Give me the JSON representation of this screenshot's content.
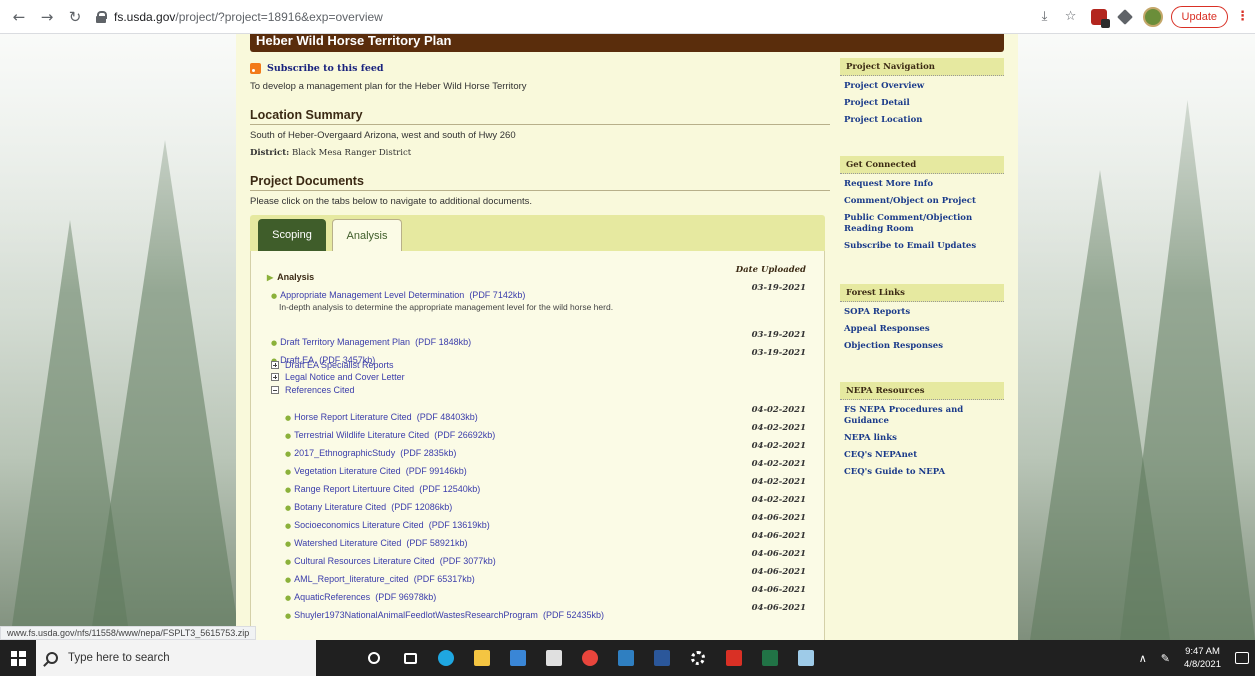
{
  "browser": {
    "url_host": "fs.usda.gov",
    "url_path": "/project/?project=18916&exp=overview",
    "update_label": "Update"
  },
  "page": {
    "title": "Heber Wild Horse Territory Plan",
    "feed_link": "Subscribe to this feed",
    "intro": "To develop a management plan for the Heber Wild Horse Territory",
    "location_heading": "Location Summary",
    "location_text": "South of Heber-Overgaard Arizona, west and south of Hwy 260",
    "district_label": "District:",
    "district_value": "Black Mesa Ranger District",
    "docs_heading": "Project Documents",
    "docs_text": "Please click on the tabs below to navigate to additional documents.",
    "tabs": [
      "Scoping",
      "Analysis"
    ],
    "folder_title": "Analysis",
    "date_header": "Date Uploaded",
    "docs": [
      {
        "link": "Appropriate Management Level Determination",
        "size": "(PDF 7142kb)",
        "date": "03-19-2021",
        "desc": "In-depth analysis to determine the appropriate management level for the wild horse herd."
      },
      {
        "link": "Draft Territory Management Plan",
        "size": "(PDF 1848kb)",
        "date": "03-19-2021"
      },
      {
        "link": "Draft EA",
        "size": "(PDF 3457kb)",
        "date": "03-19-2021"
      }
    ],
    "tree_items": [
      {
        "label": "Draft EA Specialist Reports",
        "expanded": false
      },
      {
        "label": "Legal Notice and Cover Letter",
        "expanded": false
      },
      {
        "label": "References Cited",
        "expanded": true
      }
    ],
    "refs": [
      {
        "link": "Horse Report Literature Cited",
        "size": "(PDF 48403kb)",
        "date": "04-02-2021"
      },
      {
        "link": "Terrestrial Wildlife Literature Cited",
        "size": "(PDF 26692kb)",
        "date": "04-02-2021"
      },
      {
        "link": "2017_EthnographicStudy",
        "size": "(PDF 2835kb)",
        "date": "04-02-2021"
      },
      {
        "link": "Vegetation Literature Cited",
        "size": "(PDF 99146kb)",
        "date": "04-02-2021"
      },
      {
        "link": "Range Report Litertuure Cited",
        "size": "(PDF 12540kb)",
        "date": "04-02-2021"
      },
      {
        "link": "Botany Literature Cited",
        "size": "(PDF 12086kb)",
        "date": "04-02-2021"
      },
      {
        "link": "Socioeconomics Literature Cited",
        "size": "(PDF 13619kb)",
        "date": "04-06-2021"
      },
      {
        "link": "Watershed Literature Cited",
        "size": "(PDF 58921kb)",
        "date": "04-06-2021"
      },
      {
        "link": "Cultural Resources Literature Cited",
        "size": "(PDF 3077kb)",
        "date": "04-06-2021"
      },
      {
        "link": "AML_Report_literature_cited",
        "size": "(PDF 65317kb)",
        "date": "04-06-2021"
      },
      {
        "link": "AquaticReferences",
        "size": "(PDF 96978kb)",
        "date": "04-06-2021"
      },
      {
        "link": "Shuyler1973NationalAnimalFeedlotWastesResearchProgram",
        "size": "(PDF 52435kb)",
        "date": "04-06-2021"
      }
    ]
  },
  "sidebar": [
    {
      "heading": "Project Navigation",
      "links": [
        "Project Overview",
        "Project Detail",
        "Project Location"
      ]
    },
    {
      "heading": "Get Connected",
      "links": [
        "Request More Info",
        "Comment/Object on Project",
        "Public Comment/Objection Reading Room",
        "Subscribe to Email Updates"
      ]
    },
    {
      "heading": "Forest Links",
      "links": [
        "SOPA Reports",
        "Appeal Responses",
        "Objection Responses"
      ]
    },
    {
      "heading": "NEPA Resources",
      "links": [
        "FS NEPA Procedures and Guidance",
        "NEPA links",
        "CEQ's NEPAnet",
        "CEQ's Guide to NEPA"
      ]
    }
  ],
  "status_url": "www.fs.usda.gov/nfs/11558/www/nepa/FSPLT3_5615753.zip",
  "taskbar": {
    "search_placeholder": "Type here to search",
    "time": "9:47 AM",
    "date": "4/8/2021"
  },
  "colors": {
    "title_bar": "#5a2d0c",
    "panel": "#f9f9db",
    "sidebar_header": "#e6e9a0",
    "tab_active": "#3f5d2a",
    "link": "#3b3dab"
  }
}
